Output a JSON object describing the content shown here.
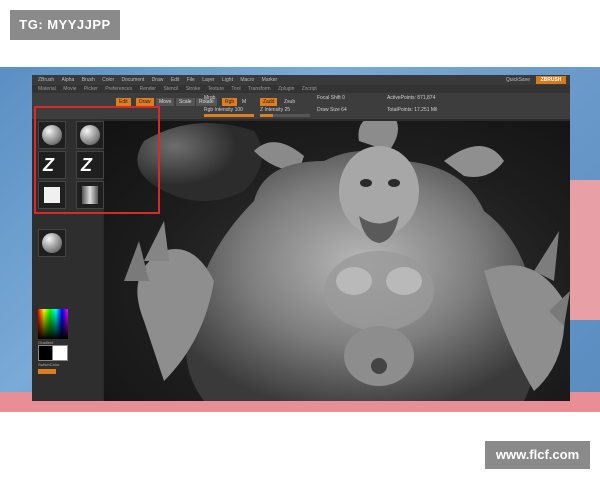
{
  "watermarks": {
    "top": "TG: MYYJJPP",
    "bottom": "www.flcf.com"
  },
  "colors": {
    "accent": "#e07d1f",
    "highlight_box": "#d62b2b"
  },
  "app": {
    "menubar": [
      "ZBrush",
      "Alpha",
      "Brush",
      "Color",
      "Document",
      "Draw",
      "Edit",
      "File",
      "Layer",
      "Light",
      "Macro",
      "Marker",
      "Material",
      "Movie",
      "Picker",
      "Preferences",
      "Render",
      "Stencil",
      "Stroke",
      "Texture",
      "Tool",
      "Transform",
      "Zplugin",
      "Zscript"
    ],
    "menubar_right": "QuickSave",
    "logo_text": "ZBRUSH",
    "toolbar": {
      "mode_buttons": [
        "Edit",
        "Draw",
        "Move",
        "Scale",
        "Rotate"
      ],
      "mrgb_label": "Mrgb",
      "rgb_label": "Rgb",
      "m_label": "M",
      "zadd_label": "Zadd",
      "zsub_label": "Zsub",
      "focal_label": "Focal Shift 0",
      "draw_size_label": "Draw Size 64",
      "rgb_intensity_label": "Rgb Intensity 100",
      "z_intensity_label": "Z Intensity 25",
      "active_points_label": "ActivePoints: 871,874",
      "total_points_label": "TotalPoints: 17.251 Mil",
      "rgb_intensity": 1.0,
      "z_intensity": 0.25
    },
    "left_panel": {
      "thumbnails": [
        "standard-brush",
        "clay-brush",
        "freehand-stroke",
        "dragrect-stroke",
        "alpha-flat",
        "texture-gradient",
        "material-sphere",
        "material-sphere-2"
      ],
      "gradient_label": "Gradient",
      "switch_label": "SwitchColor"
    },
    "viewport": {
      "subject": "demon sculpt"
    }
  }
}
